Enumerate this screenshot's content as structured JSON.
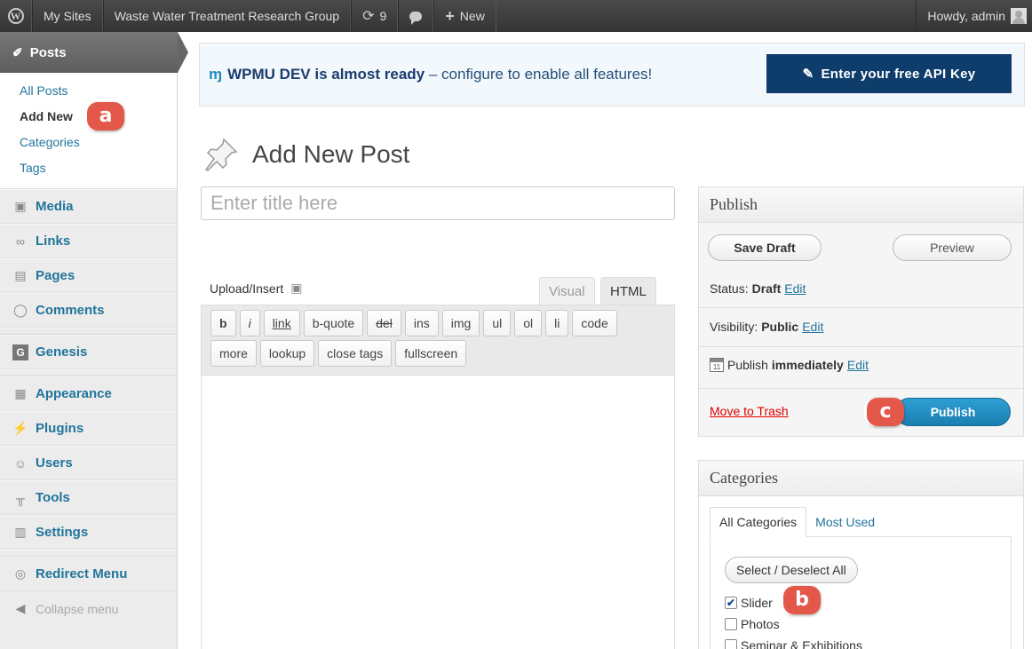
{
  "adminbar": {
    "my_sites": "My Sites",
    "site_name": "Waste Water Treatment Research Group",
    "updates_count": "9",
    "new_label": "New",
    "howdy": "Howdy, admin"
  },
  "sidebar": {
    "posts_label": "Posts",
    "submenu": [
      "All Posts",
      "Add New",
      "Categories",
      "Tags"
    ],
    "items": [
      {
        "label": "Media",
        "icon": "media-icon"
      },
      {
        "label": "Links",
        "icon": "links-icon"
      },
      {
        "label": "Pages",
        "icon": "pages-icon"
      },
      {
        "label": "Comments",
        "icon": "comments-icon"
      },
      {
        "label": "Genesis",
        "icon": "genesis-icon"
      },
      {
        "label": "Appearance",
        "icon": "appearance-icon"
      },
      {
        "label": "Plugins",
        "icon": "plugins-icon"
      },
      {
        "label": "Users",
        "icon": "users-icon"
      },
      {
        "label": "Tools",
        "icon": "tools-icon"
      },
      {
        "label": "Settings",
        "icon": "settings-icon"
      },
      {
        "label": "Redirect Menu",
        "icon": "redirect-icon"
      }
    ],
    "collapse": "Collapse menu"
  },
  "badges": {
    "a": "a",
    "b": "b",
    "c": "c"
  },
  "notice": {
    "brand": "WPMU DEV is almost ready",
    "rest": " – configure to enable all features!",
    "api_button": "Enter your free API Key"
  },
  "page": {
    "title": "Add New Post"
  },
  "title_input": {
    "placeholder": "Enter title here"
  },
  "editor": {
    "upload_insert": "Upload/Insert",
    "tab_visual": "Visual",
    "tab_html": "HTML",
    "quicktags": [
      "b",
      "i",
      "link",
      "b-quote",
      "del",
      "ins",
      "img",
      "ul",
      "ol",
      "li",
      "code",
      "more",
      "lookup",
      "close tags",
      "fullscreen"
    ]
  },
  "publish": {
    "title": "Publish",
    "save_draft": "Save Draft",
    "preview": "Preview",
    "status_label": "Status:",
    "status_value": "Draft",
    "visibility_label": "Visibility:",
    "visibility_value": "Public",
    "publish_label": "Publish",
    "publish_value": "immediately",
    "edit": "Edit",
    "trash": "Move to Trash",
    "publish_button": "Publish"
  },
  "categories": {
    "title": "Categories",
    "tab_all": "All Categories",
    "tab_used": "Most Used",
    "select_all": "Select / Deselect All",
    "items": [
      {
        "label": "Slider",
        "checked": true
      },
      {
        "label": "Photos",
        "checked": false
      },
      {
        "label": "Seminar & Exhibitions",
        "checked": false
      }
    ]
  },
  "colors": {
    "admin_bar": "#464646",
    "link": "#21759b",
    "badge": "#e4584a",
    "publish": "#2e9fd2",
    "api_button": "#0e3d6b"
  }
}
